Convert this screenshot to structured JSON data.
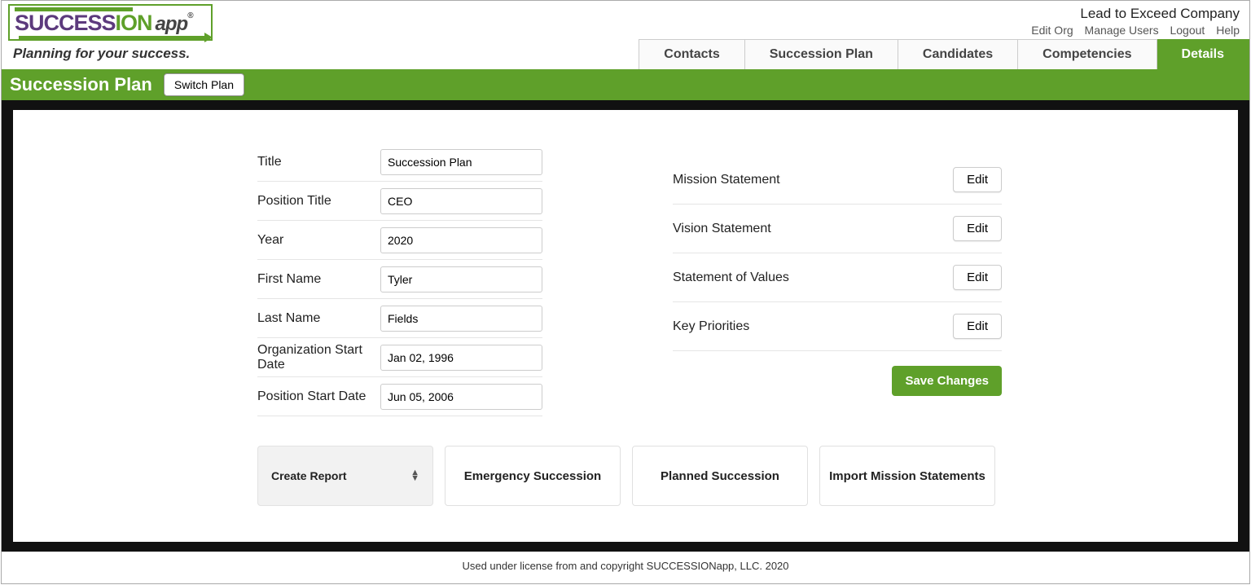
{
  "header": {
    "logo_part1": "SUCCESS",
    "logo_part2": "ION",
    "logo_part3": "app",
    "logo_reg": "®",
    "tagline": "Planning for your success.",
    "company": "Lead to Exceed Company",
    "links": {
      "edit_org": "Edit Org",
      "manage_users": "Manage Users",
      "logout": "Logout",
      "help": "Help"
    },
    "tabs": {
      "contacts": "Contacts",
      "succession_plan": "Succession Plan",
      "candidates": "Candidates",
      "competencies": "Competencies",
      "details": "Details"
    }
  },
  "green_bar": {
    "title": "Succession Plan",
    "switch_plan": "Switch Plan"
  },
  "form": {
    "labels": {
      "title": "Title",
      "position_title": "Position Title",
      "year": "Year",
      "first_name": "First Name",
      "last_name": "Last Name",
      "org_start_date": "Organization Start Date",
      "position_start_date": "Position Start Date"
    },
    "values": {
      "title": "Succession Plan",
      "position_title": "CEO",
      "year": "2020",
      "first_name": "Tyler",
      "last_name": "Fields",
      "org_start_date": "Jan 02, 1996",
      "position_start_date": "Jun 05, 2006"
    }
  },
  "statements": {
    "mission": "Mission Statement",
    "vision": "Vision Statement",
    "values": "Statement of Values",
    "priorities": "Key Priorities",
    "edit": "Edit",
    "save": "Save Changes"
  },
  "actions": {
    "create_report": "Create Report",
    "emergency": "Emergency Succession",
    "planned": "Planned Succession",
    "import": "Import Mission Statements"
  },
  "footer": "Used under license from and copyright SUCCESSIONapp, LLC. 2020"
}
